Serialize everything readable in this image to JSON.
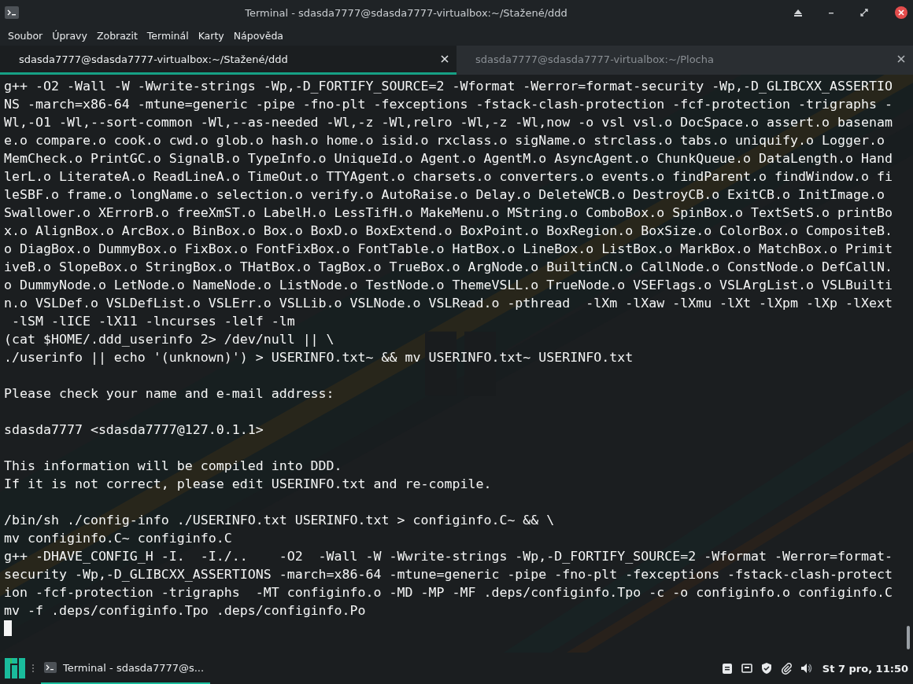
{
  "window": {
    "title": "Terminal - sdasda7777@sdasda7777-virtualbox:~/Stažené/ddd"
  },
  "menu": [
    "Soubor",
    "Úpravy",
    "Zobrazit",
    "Terminál",
    "Karty",
    "Nápověda"
  ],
  "tabs": [
    {
      "label": "sdasda7777@sdasda7777-virtualbox:~/Stažené/ddd",
      "selected": true
    },
    {
      "label": "sdasda7777@sdasda7777-virtualbox:~/Plocha",
      "selected": false
    }
  ],
  "terminal": {
    "cursor": true,
    "blocks": [
      [
        "g++ -O2 -Wall -W -Wwrite-strings -Wp,-D_FORTIFY_SOURCE=2 -Wformat -Werror=format-security -Wp,-D_GLIBCXX_ASSERTIO",
        "NS -march=x86-64 -mtune=generic -pipe -fno-plt -fexceptions -fstack-clash-protection -fcf-protection -trigraphs -",
        "Wl,-O1 -Wl,--sort-common -Wl,--as-needed -Wl,-z -Wl,relro -Wl,-z -Wl,now -o vsl vsl.o DocSpace.o assert.o basenam",
        "e.o compare.o cook.o cwd.o glob.o hash.o home.o isid.o rxclass.o sigName.o strclass.o tabs.o uniquify.o Logger.o",
        "MemCheck.o PrintGC.o SignalB.o TypeInfo.o UniqueId.o Agent.o AgentM.o AsyncAgent.o ChunkQueue.o DataLength.o Hand",
        "lerL.o LiterateA.o ReadLineA.o TimeOut.o TTYAgent.o charsets.o converters.o events.o findParent.o findWindow.o fi",
        "leSBF.o frame.o longName.o selection.o verify.o AutoRaise.o Delay.o DeleteWCB.o DestroyCB.o ExitCB.o InitImage.o",
        "Swallower.o XErrorB.o freeXmST.o LabelH.o LessTifH.o MakeMenu.o MString.o ComboBox.o SpinBox.o TextSetS.o printBo",
        "x.o AlignBox.o ArcBox.o BinBox.o Box.o BoxD.o BoxExtend.o BoxPoint.o BoxRegion.o BoxSize.o ColorBox.o CompositeB.",
        "o DiagBox.o DummyBox.o FixBox.o FontFixBox.o FontTable.o HatBox.o LineBox.o ListBox.o MarkBox.o MatchBox.o Primit",
        "iveB.o SlopeBox.o StringBox.o THatBox.o TagBox.o TrueBox.o ArgNode.o BuiltinCN.o CallNode.o ConstNode.o DefCallN.",
        "o DummyNode.o LetNode.o NameNode.o ListNode.o TestNode.o ThemeVSLL.o TrueNode.o VSEFlags.o VSLArgList.o VSLBuilti",
        "n.o VSLDef.o VSLDefList.o VSLErr.o VSLLib.o VSLNode.o VSLRead.o -pthread  -lXm -lXaw -lXmu -lXt -lXpm -lXp -lXext",
        " -lSM -lICE -lX11 -lncurses -lelf -lm",
        "(cat $HOME/.ddd_userinfo 2> /dev/null || \\",
        "./userinfo || echo '(unknown)') > USERINFO.txt~ && mv USERINFO.txt~ USERINFO.txt"
      ],
      [
        "Please check your name and e-mail address:"
      ],
      [
        "sdasda7777 <sdasda7777@127.0.1.1>"
      ],
      [
        "This information will be compiled into DDD.",
        "If it is not correct, please edit USERINFO.txt and re-compile."
      ],
      [
        "/bin/sh ./config-info ./USERINFO.txt USERINFO.txt > configinfo.C~ && \\",
        "mv configinfo.C~ configinfo.C",
        "g++ -DHAVE_CONFIG_H -I.  -I./..    -O2  -Wall -W -Wwrite-strings -Wp,-D_FORTIFY_SOURCE=2 -Wformat -Werror=format-",
        "security -Wp,-D_GLIBCXX_ASSERTIONS -march=x86-64 -mtune=generic -pipe -fno-plt -fexceptions -fstack-clash-protect",
        "ion -fcf-protection -trigraphs  -MT configinfo.o -MD -MP -MF .deps/configinfo.Tpo -c -o configinfo.o configinfo.C",
        "mv -f .deps/configinfo.Tpo .deps/configinfo.Po"
      ]
    ]
  },
  "taskbar": {
    "tasks": [
      {
        "label": "Terminal - sdasda7777@s...",
        "selected": true
      }
    ],
    "clock": "St 7 pro, 11:50"
  }
}
